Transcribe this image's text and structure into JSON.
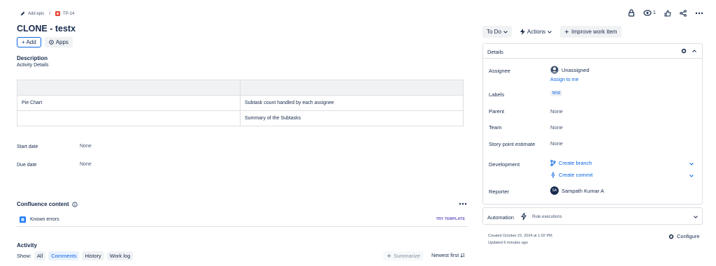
{
  "breadcrumb": {
    "add_epic": "Add epic",
    "separator": "/",
    "issue_key": "TP-14",
    "issue_color": "#e5493a"
  },
  "header_actions": {
    "watch_count": "1"
  },
  "issue": {
    "title": "CLONE - testx",
    "add_label": "+ Add",
    "apps_label": "Apps",
    "description_heading": "Description",
    "description_text": "Activity Details"
  },
  "table": {
    "rows": [
      [
        "Pie Chart",
        "Subtask count handled by each assignee"
      ],
      [
        "",
        "Summary of the Subtasks"
      ]
    ]
  },
  "dates": {
    "start_label": "Start date",
    "start_value": "None",
    "due_label": "Due date",
    "due_value": "None"
  },
  "confluence": {
    "heading": "Confluence content",
    "item": "Known errors",
    "try_template": "TRY TEMPLATE"
  },
  "activity": {
    "heading": "Activity",
    "show_label": "Show:",
    "tabs": [
      "All",
      "Comments",
      "History",
      "Work log"
    ],
    "summarize": "Summarize",
    "sort": "Newest first"
  },
  "side": {
    "status": "To Do",
    "actions": "Actions",
    "improve": "Improve work item",
    "details_heading": "Details",
    "assignee_label": "Assignee",
    "assignee_value": "Unassigned",
    "assign_to_me": "Assign to me",
    "labels_label": "Labels",
    "labels_value": "test",
    "parent_label": "Parent",
    "parent_value": "None",
    "team_label": "Team",
    "team_value": "None",
    "story_label": "Story point estimate",
    "story_value": "None",
    "dev_label": "Development",
    "create_branch": "Create branch",
    "create_commit": "Create commit",
    "reporter_label": "Reporter",
    "reporter_initials": "SA",
    "reporter_name": "Sampath Kumar A",
    "automation_label": "Automation",
    "rule_executions": "Rule executions",
    "created": "Created October 22, 2024 at 1:02 PM",
    "updated": "Updated 6 minutes ago",
    "configure": "Configure"
  }
}
